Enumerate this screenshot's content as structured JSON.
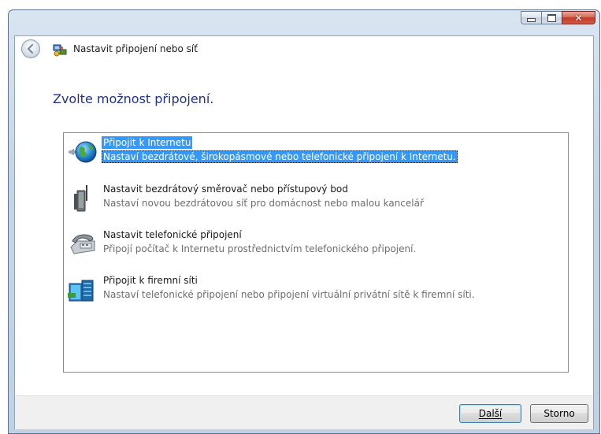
{
  "window": {
    "title": "Nastavit připojení nebo síť",
    "caption_buttons": [
      "minimize-icon",
      "maximize-icon",
      "close-icon"
    ]
  },
  "heading": "Zvolte možnost připojení.",
  "options": [
    {
      "title": "Připojit k Internetu",
      "description": "Nastaví bezdrátové, širokopásmové nebo telefonické připojení k Internetu.",
      "icon": "globe-network-icon",
      "selected": true
    },
    {
      "title": "Nastavit bezdrátový směrovač nebo přístupový bod",
      "description": "Nastaví novou bezdrátovou síť pro domácnost nebo malou kancelář",
      "icon": "wireless-router-icon",
      "selected": false
    },
    {
      "title": "Nastavit telefonické připojení",
      "description": "Připojí počítač k Internetu prostřednictvím telefonického připojení.",
      "icon": "dialup-phone-icon",
      "selected": false
    },
    {
      "title": "Připojit k firemní síti",
      "description": "Nastaví telefonické připojení nebo připojení virtuální privátní sítě k firemní síti.",
      "icon": "workplace-network-icon",
      "selected": false
    }
  ],
  "buttons": {
    "next": "Další",
    "cancel": "Storno"
  },
  "colors": {
    "selection": "#3399ff",
    "heading": "#1e3287",
    "description": "#6d6d6d"
  }
}
